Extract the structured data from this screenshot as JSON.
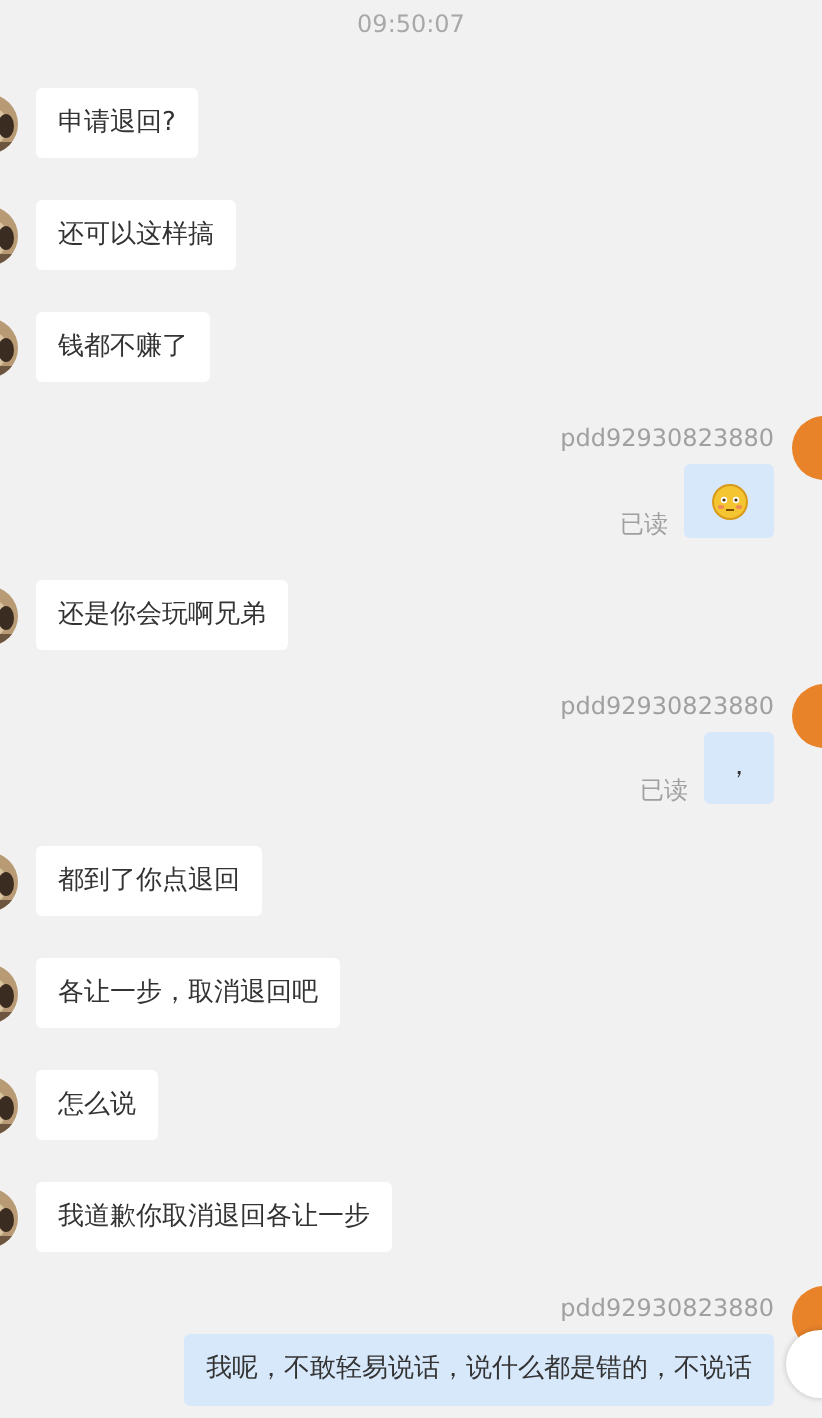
{
  "timestamp": "09:50:07",
  "messages": [
    {
      "kind": "incoming_text",
      "text": "申请退回?"
    },
    {
      "kind": "incoming_text",
      "text": "还可以这样搞"
    },
    {
      "kind": "incoming_text",
      "text": "钱都不赚了"
    },
    {
      "kind": "outgoing_emoji",
      "sender": "pdd92930823880",
      "status": "已读"
    },
    {
      "kind": "incoming_text",
      "text": "还是你会玩啊兄弟"
    },
    {
      "kind": "outgoing_text",
      "text": "，",
      "sender": "pdd92930823880",
      "status": "已读"
    },
    {
      "kind": "incoming_text",
      "text": "都到了你点退回"
    },
    {
      "kind": "incoming_text",
      "text": "各让一步，取消退回吧"
    },
    {
      "kind": "incoming_text",
      "text": "怎么说"
    },
    {
      "kind": "incoming_text",
      "text": "我道歉你取消退回各让一步"
    },
    {
      "kind": "outgoing_text",
      "text": "我呢，不敢轻易说话，说什么都是错的，不说话",
      "sender": "pdd92930823880"
    }
  ]
}
